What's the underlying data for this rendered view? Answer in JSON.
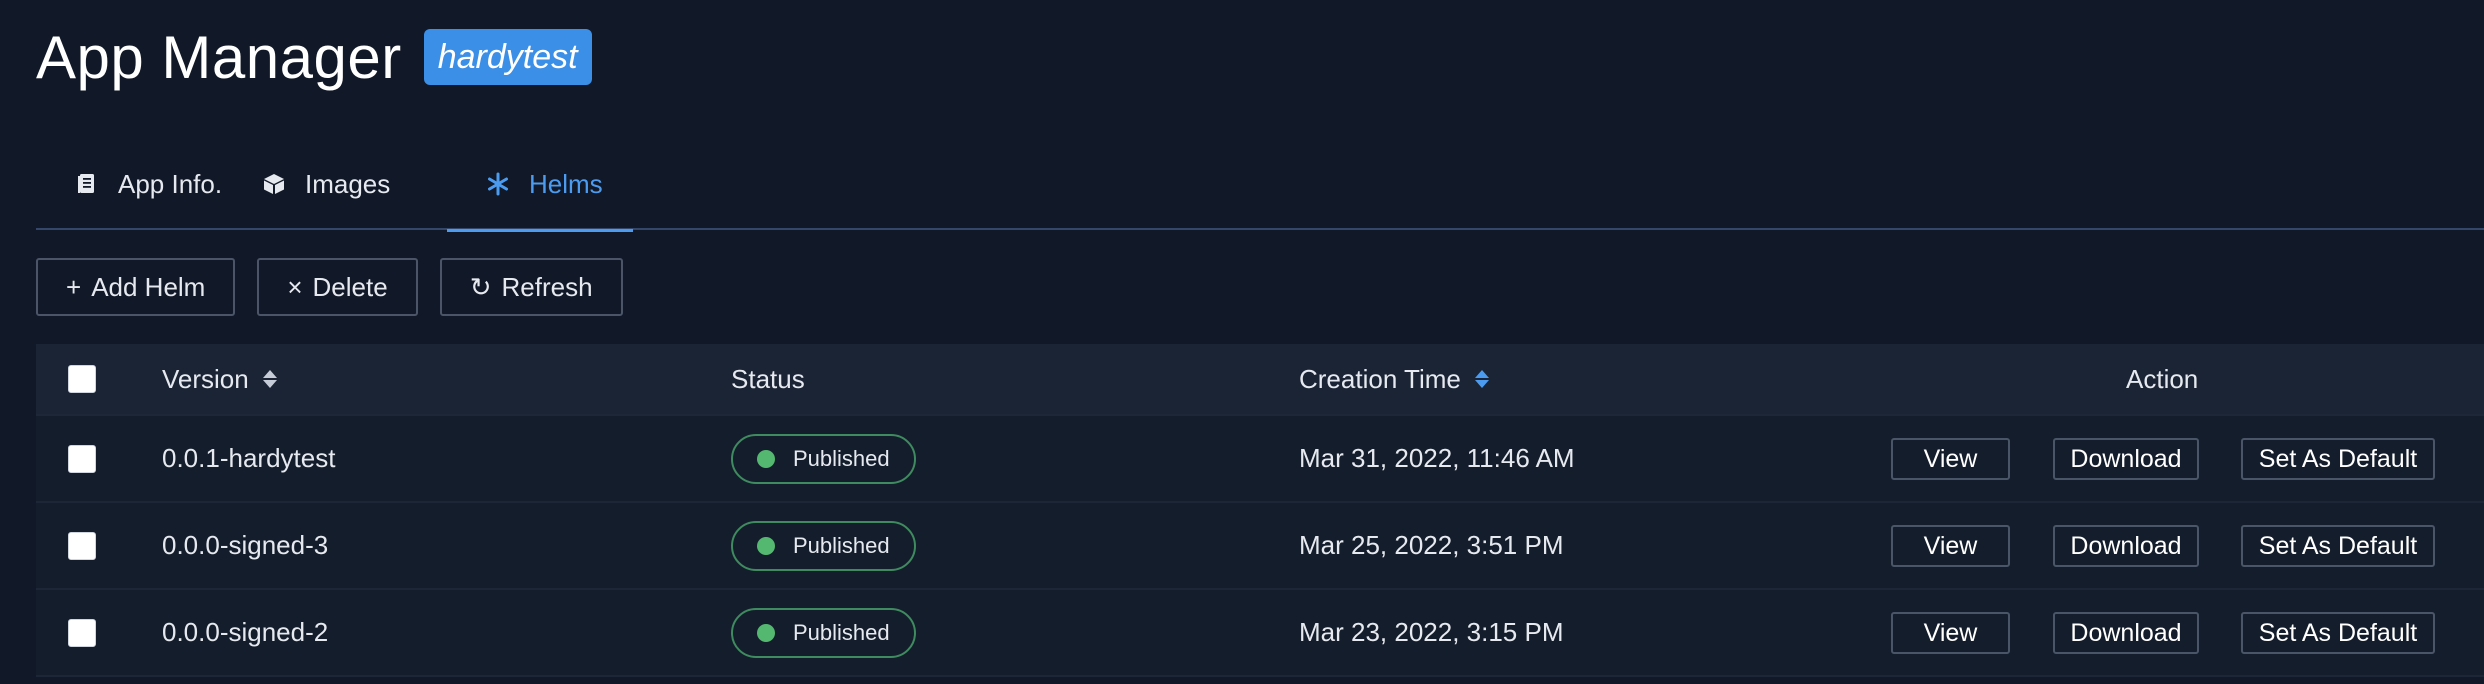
{
  "header": {
    "title": "App Manager",
    "badge": "hardytest"
  },
  "tabs": [
    {
      "label": "App Info.",
      "icon": "document-icon",
      "active": false
    },
    {
      "label": "Images",
      "icon": "cube-icon",
      "active": false
    },
    {
      "label": "Helms",
      "icon": "asterisk-icon",
      "active": true
    }
  ],
  "toolbar": {
    "add_label": "Add Helm",
    "delete_label": "Delete",
    "refresh_label": "Refresh"
  },
  "table": {
    "columns": {
      "version": "Version",
      "status": "Status",
      "creation_time": "Creation Time",
      "action": "Action"
    },
    "rows": [
      {
        "version": "0.0.1-hardytest",
        "status": "Published",
        "creation_time": "Mar 31, 2022, 11:46 AM"
      },
      {
        "version": "0.0.0-signed-3",
        "status": "Published",
        "creation_time": "Mar 25, 2022, 3:51 PM"
      },
      {
        "version": "0.0.0-signed-2",
        "status": "Published",
        "creation_time": "Mar 23, 2022, 3:15 PM"
      }
    ],
    "actions": {
      "view": "View",
      "download": "Download",
      "set_default": "Set As Default"
    }
  },
  "colors": {
    "background": "#111827",
    "accent": "#4b9cf0",
    "badge": "#3b8fe6",
    "published": "#55b871"
  }
}
